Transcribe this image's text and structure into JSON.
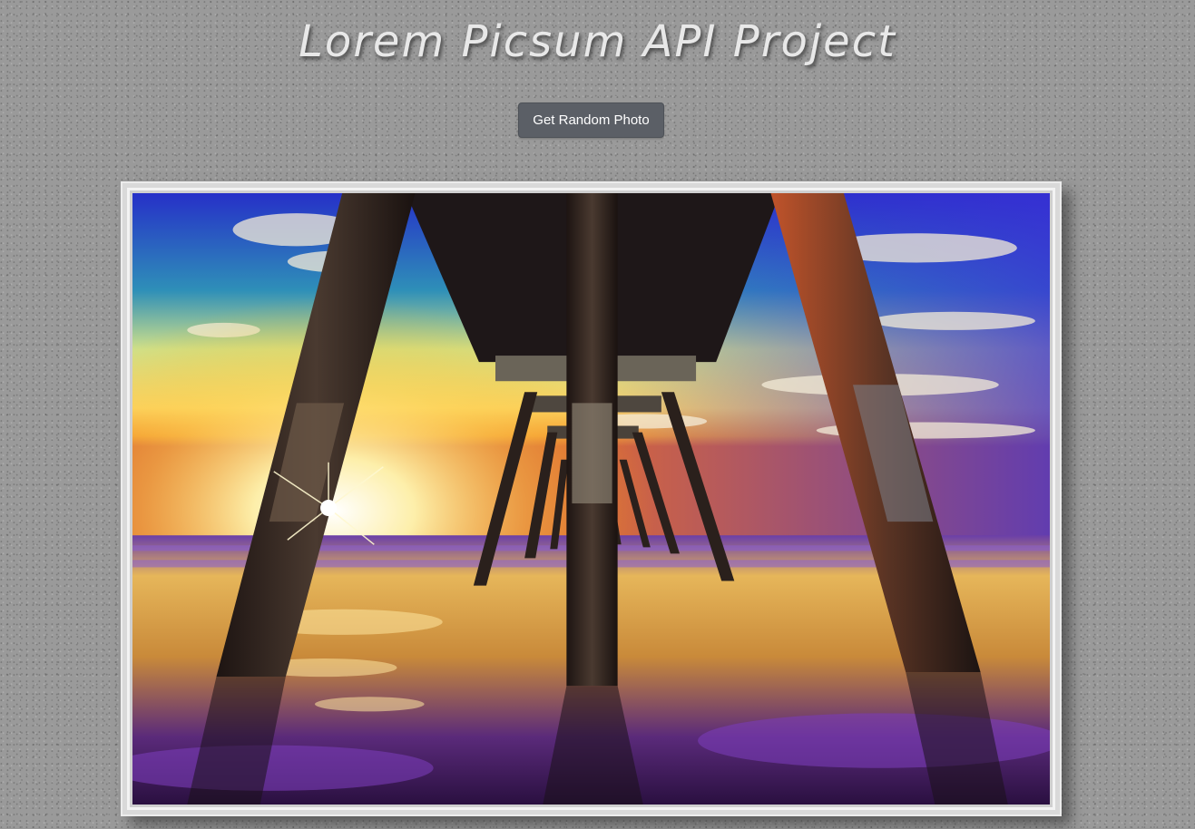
{
  "header": {
    "title": "Lorem Picsum API Project"
  },
  "controls": {
    "random_photo_label": "Get Random Photo"
  },
  "photo": {
    "subject": "Under a pier at sunset over the ocean",
    "colors": {
      "sky_top": "#2b2fd0",
      "sky_teal": "#2fa7a0",
      "sun_glow": "#fff3a8",
      "horizon": "#f5a623",
      "water_light": "#f2c35a",
      "water_dark": "#3b1c6e",
      "pier_dark": "#2a1e1a"
    }
  },
  "colors": {
    "background": "#9a9a9a",
    "button": "#5b5f66",
    "title": "#e8e8e8",
    "frame": "#d9d9d9"
  }
}
